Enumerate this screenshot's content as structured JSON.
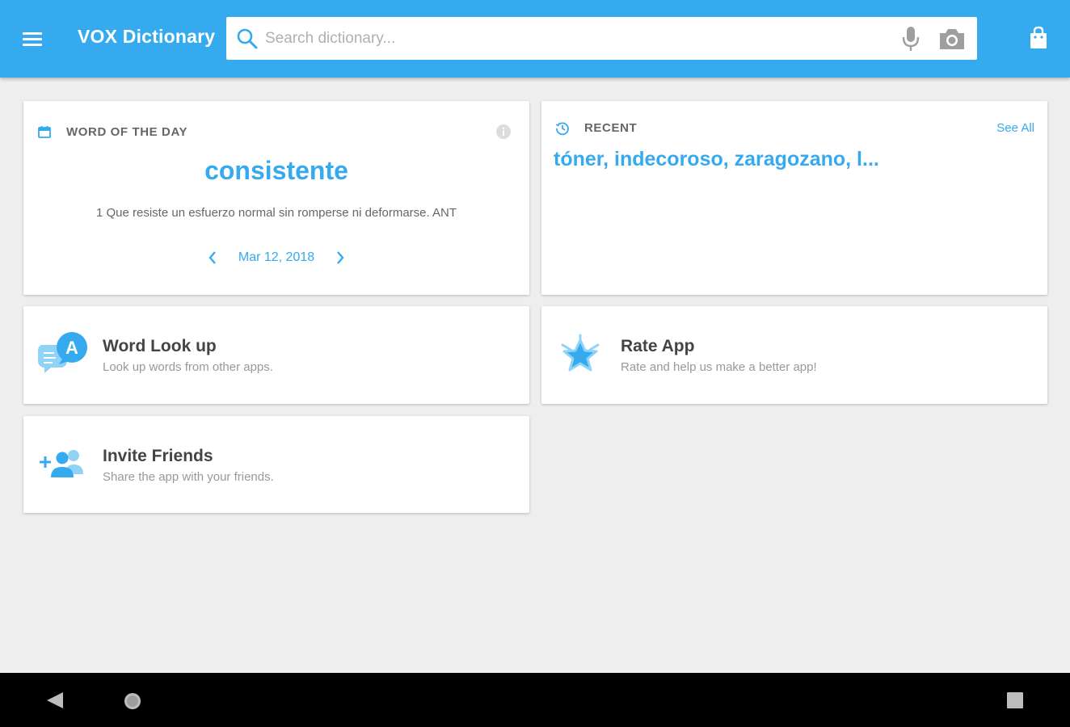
{
  "appbar": {
    "title": "VOX Dictionary",
    "search_placeholder": "Search dictionary..."
  },
  "word_of_the_day": {
    "header": "WORD OF THE DAY",
    "word": "consistente",
    "definition": "1 Que resiste un esfuerzo normal sin romperse ni deformarse. ANT",
    "date": "Mar 12, 2018"
  },
  "recent": {
    "header": "RECENT",
    "see_all": "See All",
    "words": "tóner, indecoroso, zaragozano, l..."
  },
  "features": {
    "lookup": {
      "title": "Word Look up",
      "subtitle": "Look up words from other apps."
    },
    "rate": {
      "title": "Rate App",
      "subtitle": "Rate and help us make a better app!"
    },
    "invite": {
      "title": "Invite Friends",
      "subtitle": "Share the app with your friends."
    }
  },
  "colors": {
    "accent": "#35aaef",
    "background": "#eeeeee"
  }
}
